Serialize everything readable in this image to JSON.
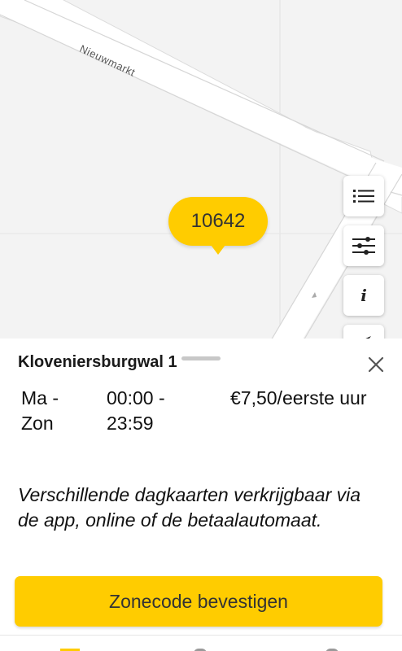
{
  "map": {
    "street_name": "Nieuwmarkt",
    "zone_code": "10642"
  },
  "map_controls": {
    "list_icon": "list-icon",
    "filter_icon": "sliders-icon",
    "info_icon": "info-icon",
    "locate_icon": "location-arrow-icon",
    "info_glyph": "i"
  },
  "zone_sheet": {
    "title": "Kloveniersburgwal 1",
    "rate": {
      "days": "Ma - Zon",
      "time": "00:00 - 23:59",
      "price": "€7,50/eerste uur"
    },
    "note": "Verschillende dagkaarten verkrijgbaar via de app, online of de betaalautomaat.",
    "confirm_label": "Zonecode bevestigen"
  },
  "colors": {
    "accent": "#ffcc00",
    "map_background": "#f3f3f3",
    "text": "#111111"
  }
}
